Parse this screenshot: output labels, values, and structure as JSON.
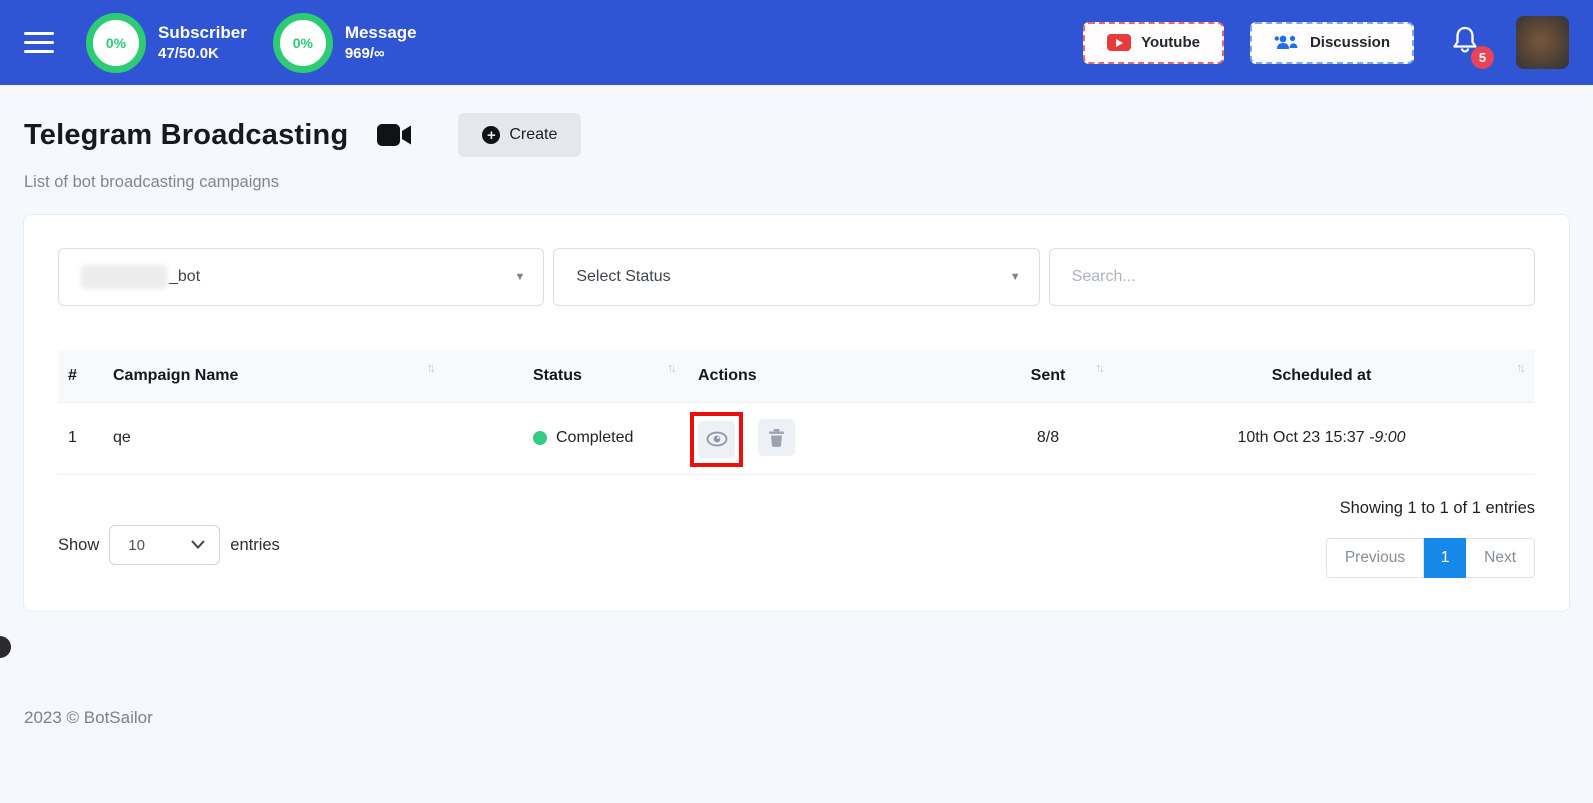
{
  "colors": {
    "navbar_blue": "#2f55d4",
    "progress_green": "#2dcb73",
    "status_green": "#33cc80",
    "badge_red": "#e8435a",
    "active_page_blue": "#1688e8",
    "annotation_red": "#ea100c"
  },
  "navbar": {
    "stats": [
      {
        "percent": "0%",
        "label": "Subscriber",
        "value": "47/50.0K"
      },
      {
        "percent": "0%",
        "label": "Message",
        "value": "969/∞"
      }
    ],
    "youtube_label": "Youtube",
    "discussion_label": "Discussion",
    "notification_count": "5"
  },
  "page": {
    "title": "Telegram Broadcasting",
    "create_label": "Create",
    "create_icon": "+",
    "subtitle": "List of bot broadcasting campaigns",
    "footer": "2023 © BotSailor"
  },
  "filters": {
    "bot_select_value": "_bot",
    "status_select_placeholder": "Select Status",
    "search_placeholder": "Search..."
  },
  "table": {
    "headers": [
      "#",
      "Campaign Name",
      "Status",
      "Actions",
      "Sent",
      "Scheduled at"
    ],
    "rows": [
      {
        "index": "1",
        "name": "qe",
        "status": "Completed",
        "sent": "8/8",
        "scheduled": "10th Oct 23 15:37 ",
        "scheduled_tz": "-9:00"
      }
    ]
  },
  "pagination": {
    "show_label": "Show",
    "page_size": "10",
    "entries_label": "entries",
    "summary": "Showing 1 to 1 of 1 entries",
    "previous_label": "Previous",
    "page_label": "1",
    "next_label": "Next"
  },
  "glyphs": {
    "sort": "↑↓",
    "caret": "▼"
  }
}
